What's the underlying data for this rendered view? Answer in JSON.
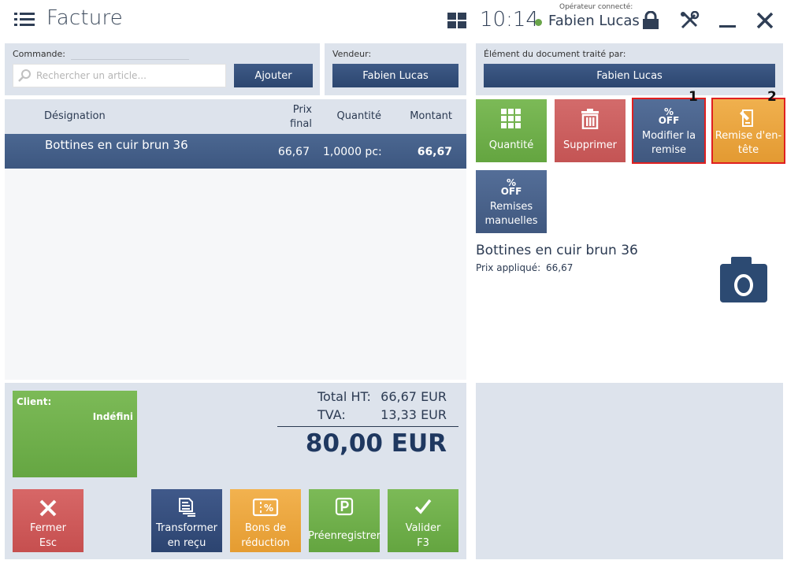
{
  "header": {
    "title": "Facture",
    "clock": "10:14",
    "operator_label": "Opérateur connecté:",
    "operator_name": "Fabien Lucas"
  },
  "commande": {
    "label": "Commande:",
    "search_placeholder": "Rechercher un article...",
    "add_label": "Ajouter"
  },
  "vendeur": {
    "label": "Vendeur:",
    "name": "Fabien Lucas"
  },
  "element": {
    "label": "Élément du document traité par:",
    "name": "Fabien Lucas"
  },
  "table": {
    "headers": {
      "designation": "Désignation",
      "prix_line1": "Prix",
      "prix_line2": "final",
      "quantite": "Quantité",
      "montant": "Montant"
    },
    "rows": [
      {
        "designation": "Bottines en cuir brun 36",
        "prix": "66,67",
        "quantite": "1,0000 pc:",
        "montant": "66,67"
      }
    ]
  },
  "actions": {
    "quantite": "Quantité",
    "supprimer": "Supprimer",
    "modifier_line1": "Modifier la",
    "modifier_line2": "remise",
    "entete_line1": "Remise d'en-",
    "entete_line2": "tête",
    "manuelles_line1": "Remises",
    "manuelles_line2": "manuelles",
    "pct_top": "%",
    "pct_bottom": "OFF",
    "marker_1": "1",
    "marker_2": "2"
  },
  "detail": {
    "name": "Bottines en cuir brun 36",
    "price_label": "Prix appliqué:",
    "price_value": "66,67"
  },
  "client": {
    "label": "Client:",
    "value": "Indéfini"
  },
  "totals": {
    "ht_label": "Total HT:",
    "ht_value": "66,67 EUR",
    "tva_label": "TVA:",
    "tva_value": "13,33 EUR",
    "grand_total": "80,00 EUR"
  },
  "footer_buttons": {
    "fermer_line1": "Fermer",
    "fermer_line2": "Esc",
    "transformer_line1": "Transformer",
    "transformer_line2": "en reçu",
    "bons_line1": "Bons de",
    "bons_line2": "réduction",
    "preenregistrer": "Préenregistrer",
    "valider_line1": "Valider",
    "valider_line2": "F3"
  },
  "colors": {
    "accent_blue": "#2c4670",
    "green": "#6aa54a",
    "red": "#c64f4f",
    "orange": "#e59c31",
    "panel_bg": "#dde3ec",
    "highlight": "#e02020"
  }
}
